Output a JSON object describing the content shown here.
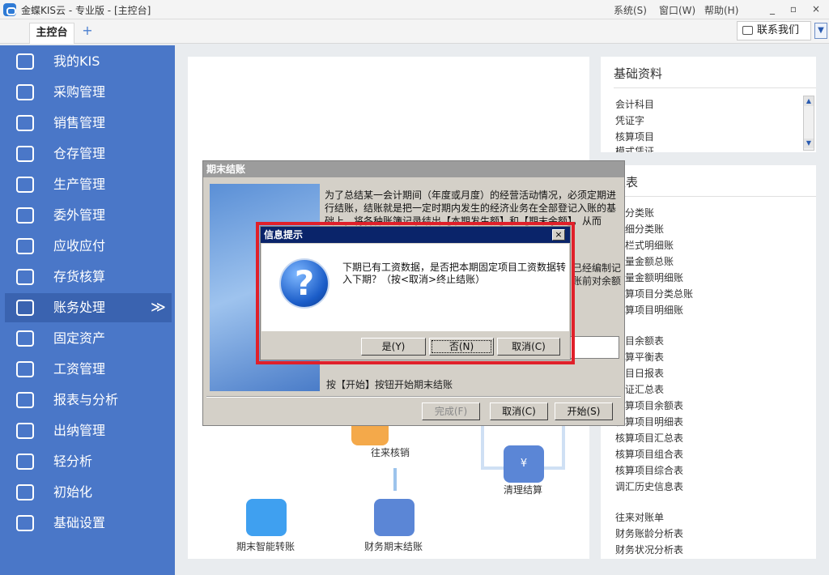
{
  "window": {
    "title": "金蝶KIS云 - 专业版 - [主控台]",
    "menu": [
      "系统(S)",
      "窗口(W)",
      "帮助(H)"
    ],
    "controls": [
      "_",
      "▫",
      "×"
    ]
  },
  "tabs": {
    "main": "主控台",
    "add": "+"
  },
  "header": {
    "contact_label": "联系我们",
    "dropdown": "▼"
  },
  "sidebar": {
    "items": [
      {
        "label": "我的KIS",
        "icon": "monitor-icon"
      },
      {
        "label": "采购管理",
        "icon": "cart-icon"
      },
      {
        "label": "销售管理",
        "icon": "users-icon"
      },
      {
        "label": "仓存管理",
        "icon": "warehouse-icon"
      },
      {
        "label": "生产管理",
        "icon": "hexagon-icon"
      },
      {
        "label": "委外管理",
        "icon": "grid-icon"
      },
      {
        "label": "应收应付",
        "icon": "yen-icon"
      },
      {
        "label": "存货核算",
        "icon": "house-search-icon"
      },
      {
        "label": "账务处理",
        "icon": "ledger-icon",
        "arrow": "≫"
      },
      {
        "label": "固定资产",
        "icon": "building-icon"
      },
      {
        "label": "工资管理",
        "icon": "wage-icon"
      },
      {
        "label": "报表与分析",
        "icon": "chart-icon"
      },
      {
        "label": "出纳管理",
        "icon": "cashier-icon"
      },
      {
        "label": "轻分析",
        "icon": "analysis-icon"
      },
      {
        "label": "初始化",
        "icon": "init-icon"
      },
      {
        "label": "基础设置",
        "icon": "settings-icon"
      }
    ]
  },
  "panels": {
    "basic": {
      "title": "基础资料",
      "items": [
        "会计科目",
        "凭证字",
        "核算项目",
        "模式凭证"
      ]
    },
    "reports": {
      "title": "报表",
      "items": [
        "总分类账",
        "明细分类账",
        "多栏式明细账",
        "数量金额总账",
        "数量金额明细账",
        "核算项目分类总账",
        "核算项目明细账",
        "科目余额表",
        "试算平衡表",
        "科目日报表",
        "凭证汇总表",
        "核算项目余额表",
        "核算项目明细表",
        "核算项目汇总表",
        "核算项目组合表",
        "核算项目综合表",
        "调汇历史信息表",
        "往来对账单",
        "财务账龄分析表",
        "财务状况分析表"
      ]
    }
  },
  "flow": {
    "nodes": [
      "往来核销",
      "清理结算",
      "期末智能转账",
      "财务期末结账"
    ]
  },
  "period_dialog": {
    "title": "期末结账",
    "description": "为了总结某一会计期间（年度或月度）的经营活动情况，必须定期进行结账，结账就是把一定时期内发生的经济业务在全部登记入账的基础上，将各种账簿记录结出【本期发生额】和【期末余额】，从而",
    "description_cont": "已经编制记账前对余额",
    "hint": "按【开始】按钮开始期末结账",
    "buttons": {
      "finish": "完成(F)",
      "cancel": "取消(C)",
      "start": "开始(S)"
    }
  },
  "message_dialog": {
    "title": "信息提示",
    "close": "×",
    "icon": "?",
    "text": "下期已有工资数据，是否把本期固定项目工资数据转入下期？（按<取消>终止结账）",
    "buttons": {
      "yes": "是(Y)",
      "no": "否(N)",
      "cancel": "取消(C)"
    }
  }
}
